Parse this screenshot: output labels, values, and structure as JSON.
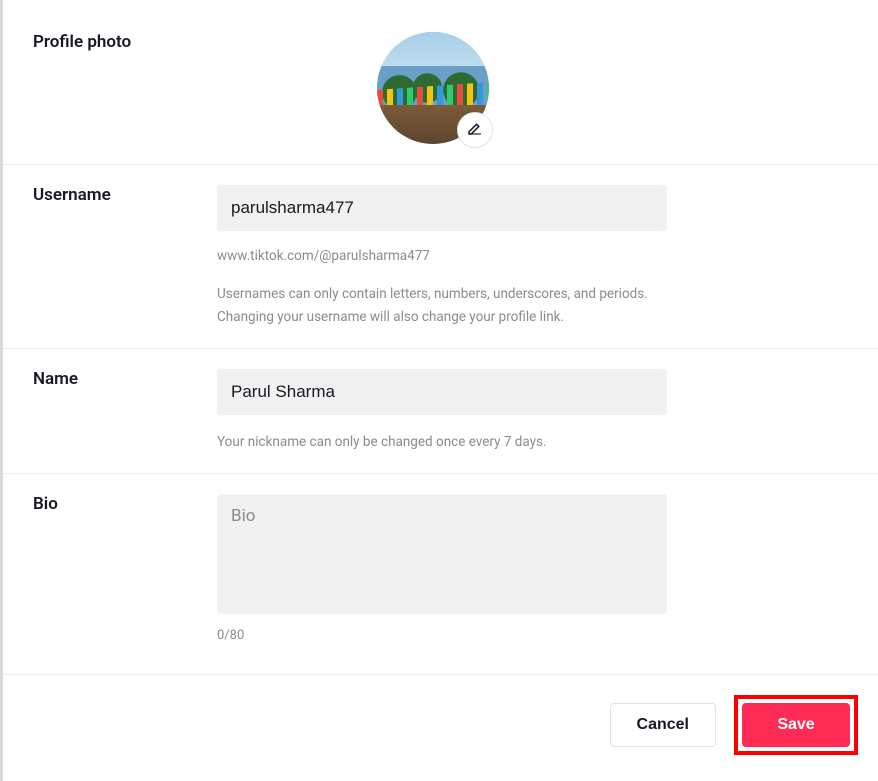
{
  "sections": {
    "profile_photo": {
      "label": "Profile photo"
    },
    "username": {
      "label": "Username",
      "value": "parulsharma477",
      "url_text": "www.tiktok.com/@parulsharma477",
      "helper": "Usernames can only contain letters, numbers, underscores, and periods. Changing your username will also change your profile link."
    },
    "name": {
      "label": "Name",
      "value": "Parul Sharma",
      "helper": "Your nickname can only be changed once every 7 days."
    },
    "bio": {
      "label": "Bio",
      "placeholder": "Bio",
      "value": "",
      "char_count": "0/80"
    }
  },
  "footer": {
    "cancel": "Cancel",
    "save": "Save"
  },
  "colors": {
    "accent": "#fe2c55",
    "highlight_box": "#ff0000"
  }
}
